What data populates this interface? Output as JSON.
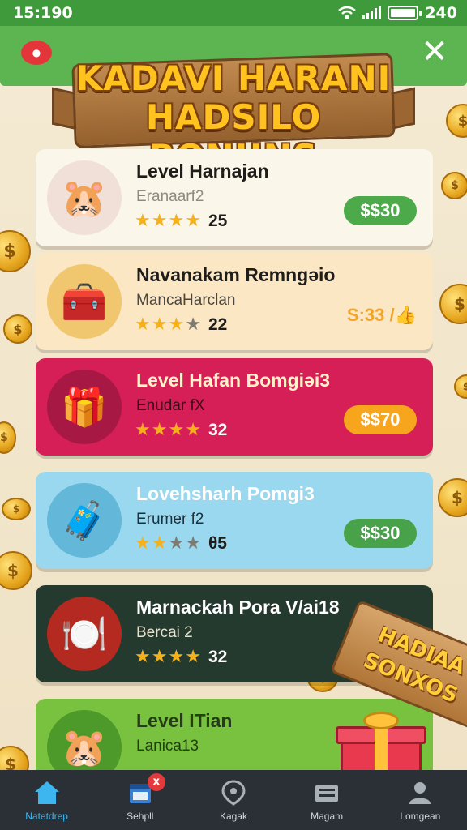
{
  "status_bar": {
    "time": "15:190",
    "battery_text": "240"
  },
  "banner": {
    "line1": "KADAVI HARANI",
    "line2": "HADSILO BONUNS"
  },
  "cards": [
    {
      "title": "Level Harnajan",
      "subtitle": "Eranaarf2",
      "stars_on": 4,
      "stars_total": 4,
      "score": "25",
      "price": "$$30",
      "avatar_icon": "hamster-avatar-icon"
    },
    {
      "title": "Navanakam Remngəio",
      "subtitle": "MancaHarclan",
      "stars_on": 3,
      "stars_total": 4,
      "score": "22",
      "price": "S:33 /👍",
      "avatar_icon": "toolbox-icon"
    },
    {
      "title": "Level Hafan Bomgiəi3",
      "subtitle": "Enudar fX",
      "stars_on": 4,
      "stars_total": 4,
      "score": "32",
      "price": "$$70",
      "avatar_icon": "gift-icon"
    },
    {
      "title": "Lovehsharh Pomgi3",
      "subtitle": "Erumer f2",
      "stars_on": 2,
      "stars_total": 4,
      "score": "θ5",
      "price": "$$30",
      "avatar_icon": "chest-icon"
    },
    {
      "title": "Marnackah Pora V/ai18",
      "subtitle": "Bercai 2",
      "stars_on": 4,
      "stars_total": 4,
      "score": "32",
      "price": "",
      "avatar_icon": "plate-icon"
    },
    {
      "title": "Level ITian",
      "subtitle": "Lanica13",
      "stars_on": 0,
      "stars_total": 0,
      "score": "",
      "price": "",
      "avatar_icon": "hamster-avatar-icon"
    }
  ],
  "promo_sign": {
    "line1": "HADIAA",
    "line2": "SONXOS"
  },
  "bottom_nav": [
    {
      "label": "Natetdrep",
      "icon": "home-icon",
      "active": true
    },
    {
      "label": "Sehpll",
      "icon": "calendar-icon",
      "badge": "x"
    },
    {
      "label": "Kagak",
      "icon": "shield-icon"
    },
    {
      "label": "Magam",
      "icon": "keyboard-icon"
    },
    {
      "label": "Lomgean",
      "icon": "person-icon"
    }
  ],
  "colors": {
    "status_bar": "#3f9a3c",
    "card_red": "#d71f57",
    "card_blue": "#99d8ee",
    "card_dark": "#243a2e",
    "price_green": "#4caa4a",
    "price_orange": "#f6a51d"
  }
}
